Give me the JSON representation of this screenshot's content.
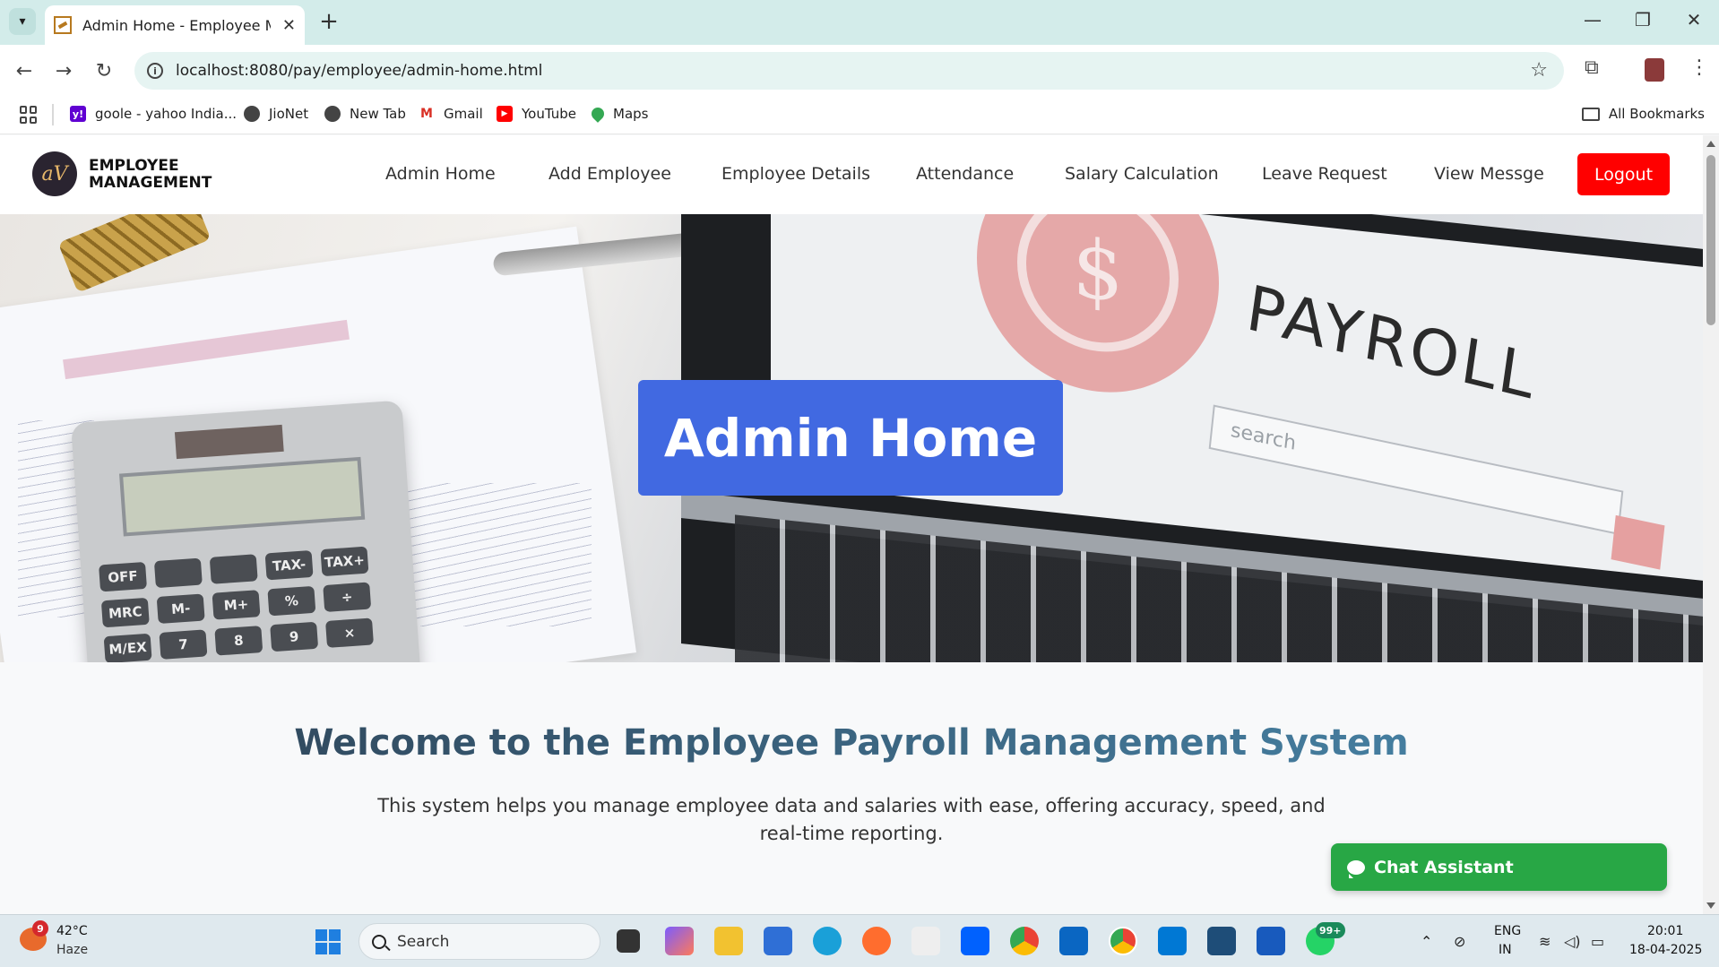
{
  "browser": {
    "tab_title": "Admin Home - Employee Management",
    "url": "localhost:8080/pay/employee/admin-home.html",
    "bookmarks": [
      {
        "label": "goole - yahoo India..."
      },
      {
        "label": "JioNet"
      },
      {
        "label": "New Tab"
      },
      {
        "label": "Gmail"
      },
      {
        "label": "YouTube"
      },
      {
        "label": "Maps"
      }
    ],
    "all_bookmarks": "All Bookmarks"
  },
  "site": {
    "logo_mark": "aV",
    "logo_line1": "EMPLOYEE",
    "logo_line2": "MANAGEMENT",
    "nav": [
      {
        "label": "Admin Home"
      },
      {
        "label": "Add Employee"
      },
      {
        "label": "Employee Details"
      },
      {
        "label": "Attendance"
      },
      {
        "label": "Salary Calculation"
      },
      {
        "label": "Leave Request"
      },
      {
        "label": "View Messge"
      }
    ],
    "logout": "Logout"
  },
  "hero": {
    "title": "Admin Home",
    "image_text": {
      "payroll": "PAYROLL",
      "search": "search",
      "dollar": "$",
      "calc_keys": [
        "OFF",
        "",
        "",
        "TAX-",
        "TAX+",
        "MRC",
        "M-",
        "M+",
        "%",
        "÷",
        "M/EX",
        "7",
        "8",
        "9",
        "×"
      ]
    }
  },
  "main": {
    "welcome": "Welcome to the Employee Payroll Management System",
    "description": "This system helps you manage employee data and salaries with ease, offering accuracy, speed, and real-time reporting."
  },
  "chat": {
    "label": "Chat Assistant"
  },
  "taskbar": {
    "weather_badge": "9",
    "temperature": "42°C",
    "condition": "Haze",
    "search_label": "Search",
    "whatsapp_badge": "99+",
    "lang1": "ENG",
    "lang2": "IN",
    "time": "20:01",
    "date": "18-04-2025"
  },
  "colors": {
    "hero_title_bg": "#4169e1",
    "logout_bg": "#ff0000",
    "chat_bg": "#28a745"
  }
}
